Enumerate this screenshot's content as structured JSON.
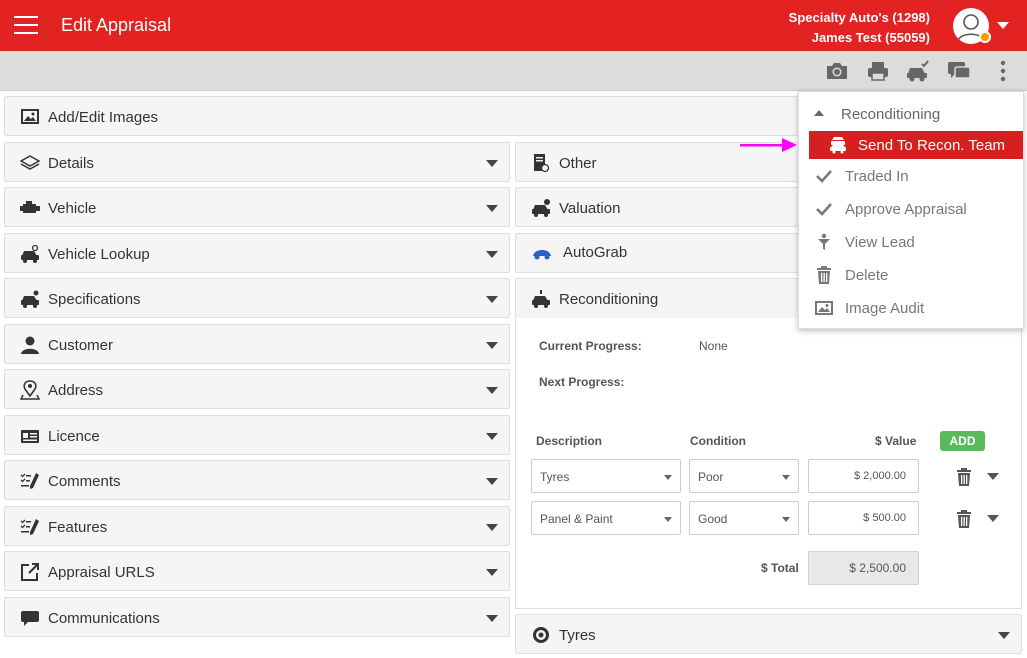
{
  "header": {
    "title": "Edit Appraisal",
    "dealer": "Specialty Auto's (1298)",
    "user": "James Test (55059)"
  },
  "left_panels": [
    {
      "label": "Details",
      "icon": "layers-icon"
    },
    {
      "label": "Vehicle",
      "icon": "engine-icon"
    },
    {
      "label": "Vehicle Lookup",
      "icon": "car-search-icon"
    },
    {
      "label": "Specifications",
      "icon": "car-settings-icon"
    },
    {
      "label": "Customer",
      "icon": "person-icon"
    },
    {
      "label": "Address",
      "icon": "map-pin-icon"
    },
    {
      "label": "Licence",
      "icon": "id-card-icon"
    },
    {
      "label": "Comments",
      "icon": "checklist-pen-icon"
    },
    {
      "label": "Features",
      "icon": "checklist-pen-icon"
    },
    {
      "label": "Appraisal URLS",
      "icon": "external-link-icon"
    },
    {
      "label": "Communications",
      "icon": "chat-icon"
    }
  ],
  "images_panel": {
    "label": "Add/Edit Images",
    "icon": "image-icon"
  },
  "right_panels": {
    "other": "Other",
    "valuation": "Valuation",
    "autograb": "AutoGrab",
    "reconditioning": "Reconditioning",
    "tyres": "Tyres"
  },
  "recon": {
    "current_progress_label": "Current Progress:",
    "current_progress_value": "None",
    "next_progress_label": "Next Progress:",
    "col_description": "Description",
    "col_condition": "Condition",
    "col_value": "$ Value",
    "add_label": "ADD",
    "rows": [
      {
        "description": "Tyres",
        "condition": "Poor",
        "value": "$ 2,000.00"
      },
      {
        "description": "Panel & Paint",
        "condition": "Good",
        "value": "$ 500.00"
      }
    ],
    "total_label": "$ Total",
    "total_value": "$ 2,500.00"
  },
  "menu": {
    "header": "Reconditioning",
    "items": [
      {
        "label": "Send To Recon. Team",
        "icon": "recon-team-icon",
        "active": true
      },
      {
        "label": "Traded In",
        "icon": "check-icon"
      },
      {
        "label": "Approve Appraisal",
        "icon": "check-icon"
      },
      {
        "label": "View Lead",
        "icon": "lead-funnel-icon"
      },
      {
        "label": "Delete",
        "icon": "trash-icon"
      },
      {
        "label": "Image Audit",
        "icon": "image-icon"
      }
    ]
  },
  "toolbar": {
    "icons": [
      "camera-icon",
      "printer-icon",
      "car-check-icon",
      "chat-icon",
      "more-vertical-icon"
    ]
  },
  "colors": {
    "brand_red": "#e32222",
    "active_menu": "#d6201f",
    "add_green": "#5cb85c",
    "arrow": "#ff00ff"
  }
}
